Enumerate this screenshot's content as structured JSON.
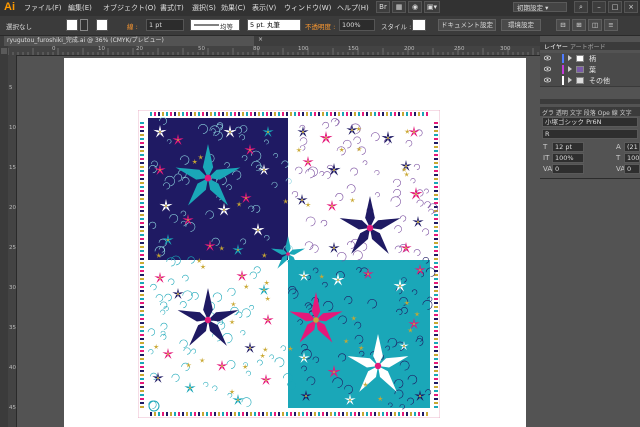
{
  "app": {
    "logo": "Ai",
    "menu": [
      "ファイル(F)",
      "編集(E)",
      "オブジェクト(O)",
      "書式(T)",
      "選択(S)",
      "効果(C)",
      "表示(V)",
      "ウィンドウ(W)",
      "ヘルプ(H)"
    ],
    "workspace": "初期設定 ▾"
  },
  "control": {
    "selection": "選択なし",
    "stroke_label": "線 :",
    "stroke_weight": "1 pt",
    "profile_label": "均等",
    "brush": "5 pt. 丸筆",
    "opacity_label": "不透明度 :",
    "opacity": "100%",
    "style_label": "スタイル :",
    "doc_settings": "ドキュメント設定",
    "env_settings": "環境設定"
  },
  "document": {
    "tab_title": "ryugutou_furoshiki_完成.ai @ 36% (CMYK/プレビュー)",
    "close": "×"
  },
  "ruler": {
    "h": [
      "0",
      "10",
      "20",
      "50",
      "80",
      "100",
      "150",
      "200",
      "250",
      "300",
      "350"
    ],
    "v": [
      "0",
      "5",
      "10",
      "15",
      "20",
      "25",
      "30",
      "35",
      "40",
      "45"
    ]
  },
  "panels": {
    "layers_tab": "レイヤー",
    "artboards_tab": "アートボード",
    "layers": [
      {
        "name": "柄",
        "color": "#4f7cff"
      },
      {
        "name": "葉",
        "color": "#c23bd8"
      },
      {
        "name": "その他",
        "color": "#ffffff"
      }
    ],
    "char_tabs": "グラ 透明 文字 段落 Ope 線 文字",
    "font_family": "小塚ゴシック Pr6N",
    "font_style": "R",
    "font_size": "12 pt",
    "leading": "(21",
    "vscale": "100%",
    "hscale": "100%",
    "tracking": "0",
    "kerning": "0"
  },
  "artwork": {
    "colors": {
      "navy": "#1f1a63",
      "teal": "#1aa7b8",
      "white": "#ffffff",
      "pink": "#e5197a",
      "gold": "#c9a832",
      "lightblue": "#8fd6e0"
    }
  }
}
